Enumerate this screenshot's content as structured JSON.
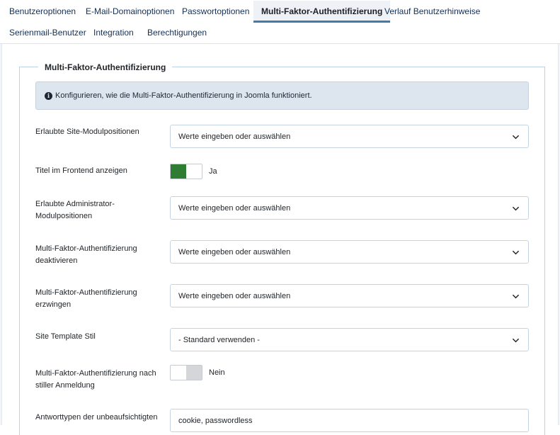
{
  "tabs": [
    {
      "label": "Benutzeroptionen"
    },
    {
      "label": "E-Mail-Domainoptionen"
    },
    {
      "label": "Passwortoptionen"
    },
    {
      "label": "Multi-Faktor-Authentifizierung",
      "active": true
    },
    {
      "label": "Verlauf Benutzerhinweise"
    },
    {
      "label": "Serienmail-Benutzer"
    },
    {
      "label": "Integration"
    },
    {
      "label": "Berechtigungen"
    }
  ],
  "fieldset": {
    "legend": "Multi-Faktor-Authentifizierung",
    "info": "Konfigurieren, wie die Multi-Faktor-Authentifizierung in Joomla funktioniert."
  },
  "fields": {
    "site_positions": {
      "label": "Erlaubte Site-Modulpositionen",
      "value": "Werte eingeben oder auswählen"
    },
    "frontend_title": {
      "label": "Titel im Frontend anzeigen",
      "value": "Ja"
    },
    "admin_positions": {
      "label": "Erlaubte Administrator-Modulpositionen",
      "value": "Werte eingeben oder auswählen"
    },
    "mfa_disable": {
      "label": "Multi-Faktor-Authentifizierung deaktivieren",
      "value": "Werte eingeben oder auswählen"
    },
    "mfa_force": {
      "label": "Multi-Faktor-Authentifizierung erzwingen",
      "value": "Werte eingeben oder auswählen"
    },
    "site_template": {
      "label": "Site Template Stil",
      "value": "- Standard verwenden -"
    },
    "silent_login": {
      "label": "Multi-Faktor-Authentifizierung nach stiller Anmeldung",
      "value": "Nein"
    },
    "response_types": {
      "label": "Antworttypen der unbeaufsichtigten",
      "value": "cookie, passwordless"
    }
  },
  "colors": {
    "accent": "#457ba8",
    "toggle_on": "#2f7d32",
    "info_bg": "#dde5ef"
  }
}
